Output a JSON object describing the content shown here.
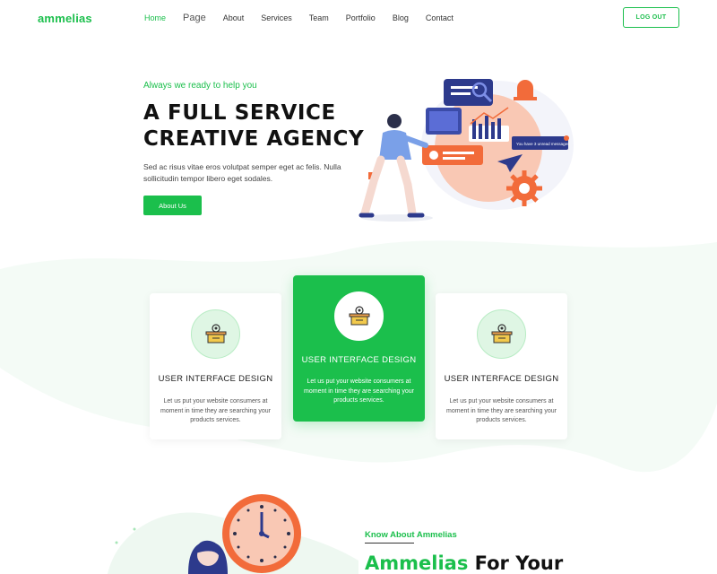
{
  "header": {
    "logo": "ammelias",
    "nav": [
      "Home",
      "Page",
      "About",
      "Services",
      "Team",
      "Portfolio",
      "Blog",
      "Contact"
    ],
    "logout_label": "LOG OUT"
  },
  "hero": {
    "kicker": "Always we ready to help you",
    "title_line1": "A FULL SERVICE",
    "title_line2": "CREATIVE AGENCY",
    "description": "Sed ac risus vitae eros volutpat semper eget ac felis. Nulla sollicitudin tempor libero eget sodales.",
    "button_label": "About Us",
    "illustration_message": "You have 3 unread messages"
  },
  "services": [
    {
      "title": "USER INTERFACE DESIGN",
      "text": "Let us put your website consumers at moment in time they are searching your products services."
    },
    {
      "title": "USER INTERFACE DESIGN",
      "text": "Let us put your website consumers at moment in time they are searching your products services."
    },
    {
      "title": "USER INTERFACE DESIGN",
      "text": "Let us put your website consumers at moment in time they are searching your products services."
    }
  ],
  "about": {
    "kicker": "Know About Ammelias",
    "title_green": "Ammelias",
    "title_rest": " For Your"
  },
  "colors": {
    "accent": "#1bbf4c",
    "illustration_orange": "#f26b3a",
    "illustration_navy": "#2d3a8c"
  }
}
